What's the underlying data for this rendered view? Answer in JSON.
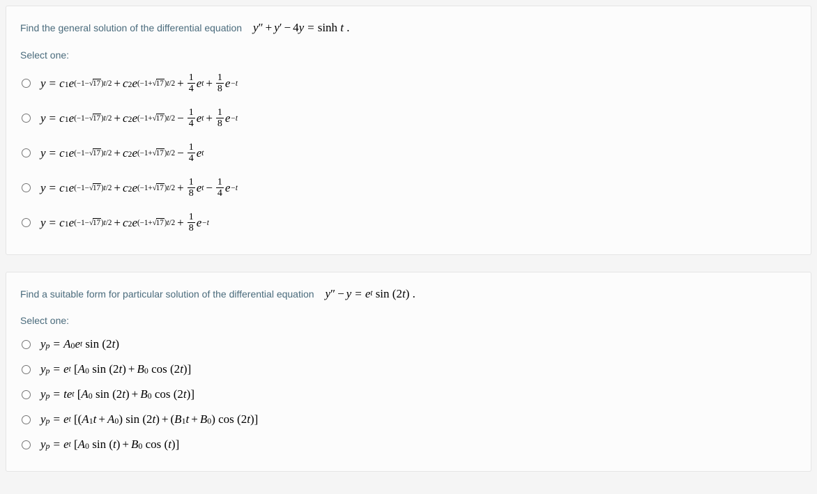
{
  "q1": {
    "prompt_text": "Find the general solution of the differential equation",
    "equation": "y″ + y′ − 4y = sinh t .",
    "select_label": "Select one:",
    "options": [
      {
        "homog": "y = c₁e^{(−1−√17)t/2} + c₂e^{(−1+√17)t/2}",
        "tail": "plus",
        "particular": "+ (1/4)e^t + (1/8)e^{−t}"
      },
      {
        "homog": "y = c₁e^{(−1−√17)t/2} + c₂e^{(−1+√17)t/2}",
        "tail": "minusplus",
        "particular": "− (1/4)e^t + (1/8)e^{−t}"
      },
      {
        "homog": "y = c₁e^{(−1−√17)t/2} + c₂e^{(−1+√17)t/2}",
        "tail": "minusone",
        "particular": "− (1/4)e^t"
      },
      {
        "homog": "y = c₁e^{(−1−√17)t/2} + c₂e^{(−1+√17)t/2}",
        "tail": "plusminus",
        "particular": "+ (1/8)e^t − (1/4)e^{−t}"
      },
      {
        "homog": "y = c₁e^{(−1−√17)t/2} + c₂e^{(−1+√17)t/2}",
        "tail": "plusone",
        "particular": "+ (1/8)e^{−t}"
      }
    ]
  },
  "q2": {
    "prompt_text": "Find a suitable form for particular solution of the differential equation",
    "equation": "y″ − y = e^t sin(2t) .",
    "select_label": "Select one:",
    "options": [
      "y_p = A₀ e^t sin(2t)",
      "y_p = e^t [A₀ sin(2t) + B₀ cos(2t)]",
      "y_p = t e^t [A₀ sin(2t) + B₀ cos(2t)]",
      "y_p = e^t [(A₁t + A₀) sin(2t) + (B₁t + B₀) cos(2t)]",
      "y_p = e^t [A₀ sin(t) + B₀ cos(t)]"
    ]
  }
}
